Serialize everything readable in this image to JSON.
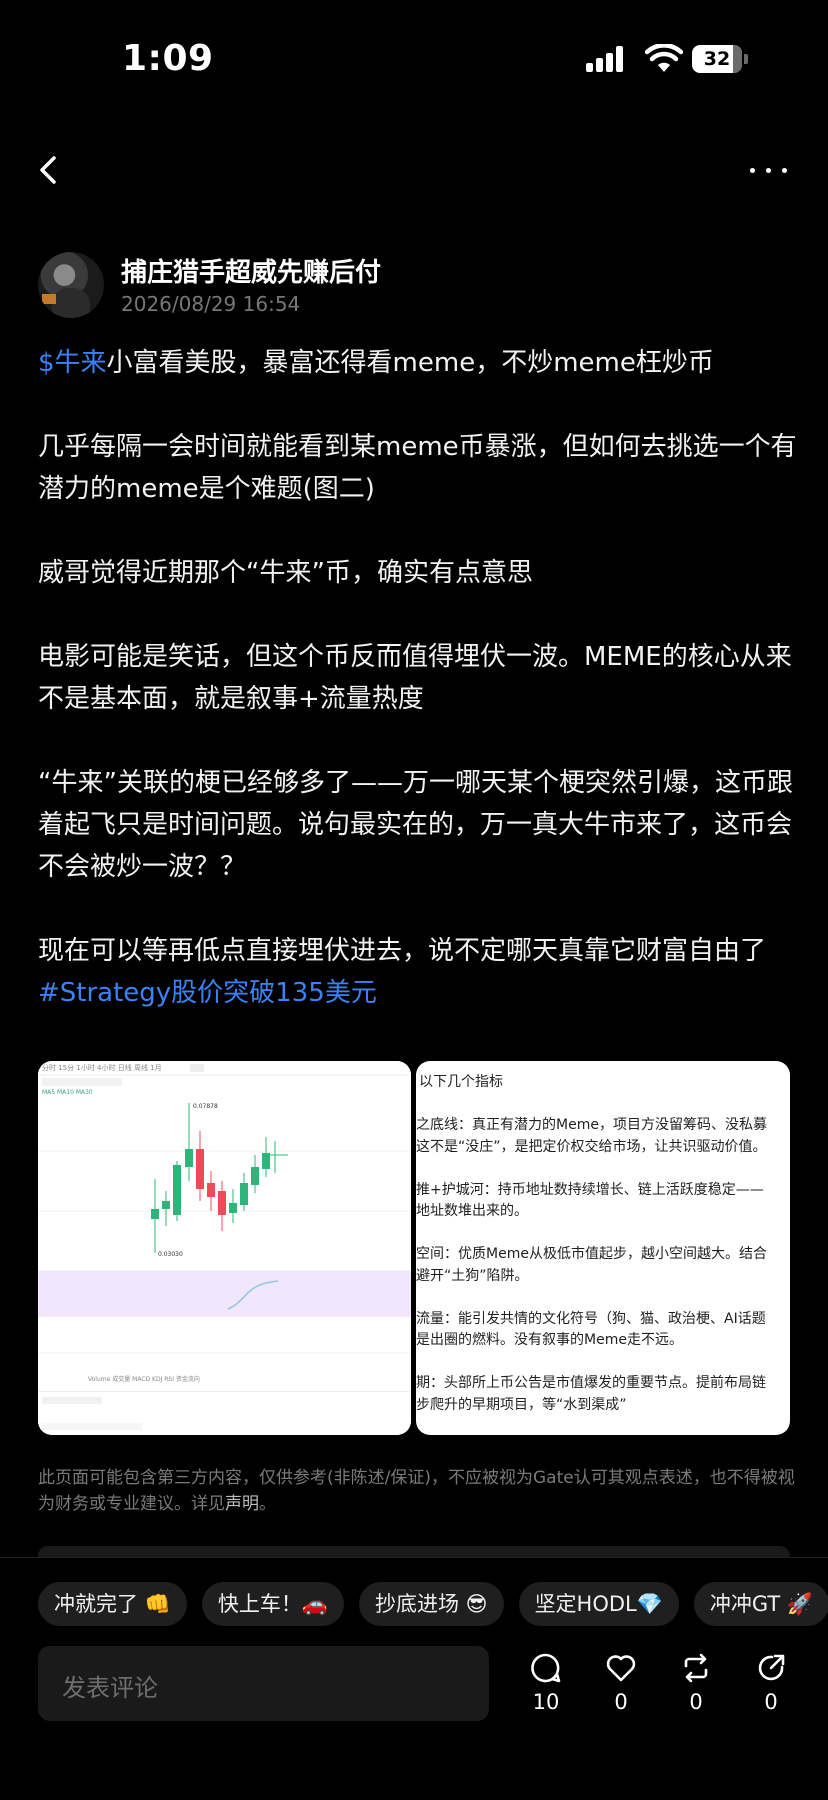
{
  "status_bar": {
    "time": "1:09",
    "battery": "32"
  },
  "author": {
    "name": "捕庄猎手超威先赚后付",
    "time": "2026/08/29 16:54"
  },
  "post": {
    "p1_tag": "$牛来",
    "p1_text": "小富看美股，暴富还得看meme，不炒meme枉炒币",
    "p2": "几乎每隔一会时间就能看到某meme币暴涨，但如何去挑选一个有潜力的meme是个难题(图二)",
    "p3": "威哥觉得近期那个“牛来”币，确实有点意思",
    "p4": "电影可能是笑话，但这个币反而值得埋伏一波。MEME的核心从来不是基本面，就是叙事+流量热度",
    "p5": "“牛来”关联的梗已经够多了——万一哪天某个梗突然引爆，这币跟着起飞只是时间问题。说句最实在的，万一真大牛市来了，这币会不会被炒一波？？",
    "p6_text": "现在可以等再低点直接埋伏进去，说不定哪天真靠它财富自由了",
    "p6_tag": "#Strategy股价突破135美元"
  },
  "image1": {
    "top_tabs": "分时 15分 1小时 4小时 日线 周线 1月",
    "high_label": "0.07878",
    "low_label": "0.03030",
    "bottom_tabs": "Volume 成交量 MACD KDJ RSI 资金流向"
  },
  "image2": {
    "lines": [
      "以下几个指标",
      "",
      "之底线：真正有潜力的Meme，项目方没留筹码、没私募",
      "这不是“没庄”，是把定价权交给市场，让共识驱动价值。",
      "",
      "推+护城河：持币地址数持续增长、链上活跃度稳定——",
      "地址数堆出来的。",
      "",
      "空间：优质Meme从极低市值起步，越小空间越大。结合",
      "避开“土狗”陷阱。",
      "",
      "流量：能引发共情的文化符号（狗、猫、政治梗、AI话题",
      "是出圈的燃料。没有叙事的Meme走不远。",
      "",
      "期：头部所上币公告是市值爆发的重要节点。提前布局链",
      "步爬升的早期项目，等“水到渠成”"
    ]
  },
  "disclaimer": {
    "text": "此页面可能包含第三方内容，仅供参考(非陈述/保证)，不应被视为Gate认可其观点表述，也不得被视为财务或专业建议。详见",
    "link": "声明",
    "end": "。"
  },
  "quick_replies": [
    "冲就完了 👊",
    "快上车！🚗",
    "抄底进场 😎",
    "坚定HODL💎",
    "冲冲GT 🚀"
  ],
  "comment_placeholder": "发表评论",
  "actions": {
    "comments": "10",
    "likes": "0",
    "reposts": "0",
    "shares": "0"
  }
}
